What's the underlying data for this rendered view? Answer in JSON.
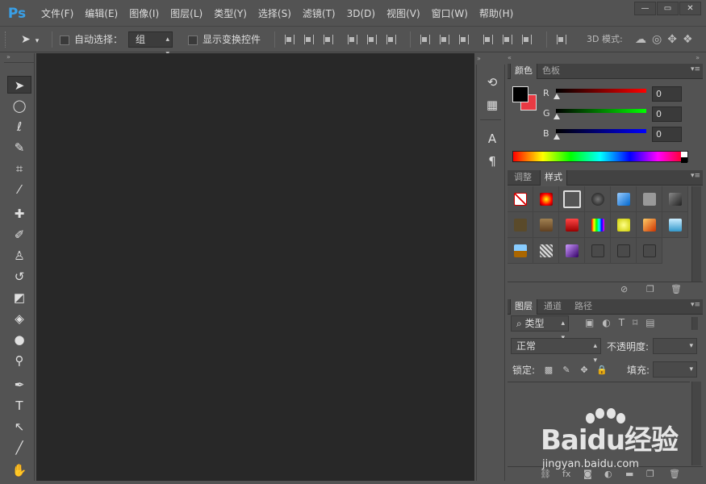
{
  "app": {
    "logo": "Ps"
  },
  "menu": [
    "文件(F)",
    "编辑(E)",
    "图像(I)",
    "图层(L)",
    "类型(Y)",
    "选择(S)",
    "滤镜(T)",
    "3D(D)",
    "视图(V)",
    "窗口(W)",
    "帮助(H)"
  ],
  "window_buttons": {
    "minimize": "—",
    "restore": "▭",
    "close": "✕"
  },
  "options": {
    "auto_select_label": "自动选择：",
    "auto_select_value": "组",
    "show_transform_label": "显示变换控件",
    "mode_3d_label": "3D 模式:"
  },
  "tools": [
    {
      "name": "move-tool-icon",
      "glyph": "➤"
    },
    {
      "name": "marquee-tool-icon",
      "glyph": "◯"
    },
    {
      "name": "lasso-tool-icon",
      "glyph": "ℓ"
    },
    {
      "name": "quick-select-tool-icon",
      "glyph": "✎"
    },
    {
      "name": "crop-tool-icon",
      "glyph": "⌗"
    },
    {
      "name": "eyedropper-tool-icon",
      "glyph": "⁄"
    },
    {
      "name": "healing-brush-tool-icon",
      "glyph": "✚"
    },
    {
      "name": "brush-tool-icon",
      "glyph": "✐"
    },
    {
      "name": "stamp-tool-icon",
      "glyph": "♙"
    },
    {
      "name": "history-brush-tool-icon",
      "glyph": "↺"
    },
    {
      "name": "eraser-tool-icon",
      "glyph": "◩"
    },
    {
      "name": "paint-bucket-tool-icon",
      "glyph": "◈"
    },
    {
      "name": "blur-tool-icon",
      "glyph": "●"
    },
    {
      "name": "dodge-tool-icon",
      "glyph": "⚲"
    },
    {
      "name": "pen-tool-icon",
      "glyph": "✒"
    },
    {
      "name": "type-tool-icon",
      "glyph": "T"
    },
    {
      "name": "path-select-tool-icon",
      "glyph": "↖"
    },
    {
      "name": "line-tool-icon",
      "glyph": "╱"
    },
    {
      "name": "hand-tool-icon",
      "glyph": "✋"
    }
  ],
  "color_panel": {
    "tabs": [
      "颜色",
      "色板"
    ],
    "r_label": "R",
    "g_label": "G",
    "b_label": "B",
    "r_value": "0",
    "g_value": "0",
    "b_value": "0",
    "colors": {
      "foreground": "#000000",
      "background": "#e83a43"
    }
  },
  "styles_panel": {
    "tabs": [
      "调整",
      "样式"
    ]
  },
  "layers_panel": {
    "tabs": [
      "图层",
      "通道",
      "路径"
    ],
    "filter_label": "类型",
    "blend_mode": "正常",
    "opacity_label": "不透明度:",
    "lock_label": "锁定:",
    "fill_label": "填充:"
  },
  "watermark": {
    "brand": "Baidu经验",
    "url": "jingyan.baidu.com"
  }
}
